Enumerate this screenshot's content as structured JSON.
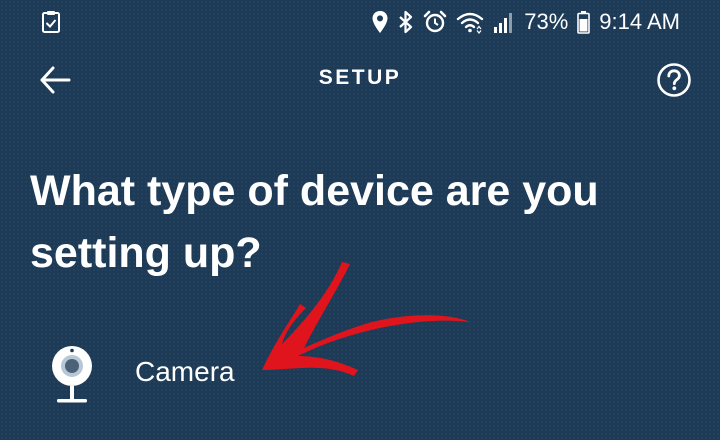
{
  "status_bar": {
    "battery_percent": "73%",
    "time": "9:14 AM",
    "icons": [
      "clipboard-check-icon",
      "location-pin-icon",
      "bluetooth-icon",
      "alarm-clock-icon",
      "wifi-icon",
      "signal-icon",
      "battery-icon"
    ]
  },
  "header": {
    "title": "SETUP",
    "back_icon": "back-arrow-icon",
    "help_icon": "help-icon"
  },
  "main": {
    "question": "What type of device are you setting up?",
    "options": [
      {
        "label": "Camera",
        "icon": "camera-icon"
      }
    ]
  },
  "annotation": {
    "type": "arrow",
    "color": "#e0141c"
  },
  "colors": {
    "background": "#1d3b57",
    "text": "#ffffff",
    "arrow": "#e0141c"
  }
}
